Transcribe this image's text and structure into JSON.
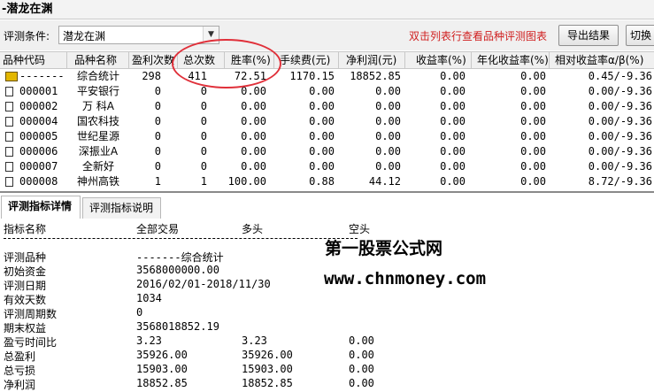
{
  "window": {
    "title": "-潜龙在渊"
  },
  "toolbar": {
    "condition_label": "评测条件:",
    "condition_value": "潜龙在渊",
    "hint": "双击列表行查看品种评测图表",
    "export_label": "导出结果",
    "switch_label": "切换"
  },
  "grid": {
    "headers": [
      "品种代码",
      "品种名称",
      "盈利次数",
      "总次数",
      "胜率(%)",
      "手续费(元)",
      "净利润(元)",
      "收益率(%)",
      "年化收益率(%)",
      "相对收益率α/β(%)"
    ],
    "rows": [
      {
        "code": "-------",
        "name": "综合统计",
        "wins": "298",
        "total": "411",
        "rate": "72.51",
        "fee": "1170.15",
        "profit": "18852.85",
        "ret": "0.00",
        "annual": "0.00",
        "rel": "0.45/-9.36",
        "icon": "summary-icon"
      },
      {
        "code": "000001",
        "name": "平安银行",
        "wins": "0",
        "total": "0",
        "rate": "0.00",
        "fee": "0.00",
        "profit": "0.00",
        "ret": "0.00",
        "annual": "0.00",
        "rel": "0.00/-9.36",
        "icon": "document-icon"
      },
      {
        "code": "000002",
        "name": "万 科A",
        "wins": "0",
        "total": "0",
        "rate": "0.00",
        "fee": "0.00",
        "profit": "0.00",
        "ret": "0.00",
        "annual": "0.00",
        "rel": "0.00/-9.36",
        "icon": "document-icon"
      },
      {
        "code": "000004",
        "name": "国农科技",
        "wins": "0",
        "total": "0",
        "rate": "0.00",
        "fee": "0.00",
        "profit": "0.00",
        "ret": "0.00",
        "annual": "0.00",
        "rel": "0.00/-9.36",
        "icon": "document-icon"
      },
      {
        "code": "000005",
        "name": "世纪星源",
        "wins": "0",
        "total": "0",
        "rate": "0.00",
        "fee": "0.00",
        "profit": "0.00",
        "ret": "0.00",
        "annual": "0.00",
        "rel": "0.00/-9.36",
        "icon": "document-icon"
      },
      {
        "code": "000006",
        "name": "深振业A",
        "wins": "0",
        "total": "0",
        "rate": "0.00",
        "fee": "0.00",
        "profit": "0.00",
        "ret": "0.00",
        "annual": "0.00",
        "rel": "0.00/-9.36",
        "icon": "document-icon"
      },
      {
        "code": "000007",
        "name": "全新好",
        "wins": "0",
        "total": "0",
        "rate": "0.00",
        "fee": "0.00",
        "profit": "0.00",
        "ret": "0.00",
        "annual": "0.00",
        "rel": "0.00/-9.36",
        "icon": "document-icon"
      },
      {
        "code": "000008",
        "name": "神州高铁",
        "wins": "1",
        "total": "1",
        "rate": "100.00",
        "fee": "0.88",
        "profit": "44.12",
        "ret": "0.00",
        "annual": "0.00",
        "rel": "8.72/-9.36",
        "icon": "document-icon"
      }
    ]
  },
  "tabs": [
    "评测指标详情",
    "评测指标说明"
  ],
  "detail": {
    "header": {
      "name": "指标名称",
      "all": "全部交易",
      "long": "多头",
      "short": "空头"
    },
    "rows": [
      {
        "label": "评测品种",
        "all": "-------综合统计",
        "long": "",
        "short": ""
      },
      {
        "label": "初始资金",
        "all": "3568000000.00",
        "long": "",
        "short": ""
      },
      {
        "label": "评测日期",
        "all": "2016/02/01-2018/11/30",
        "long": "",
        "short": ""
      },
      {
        "label": "有效天数",
        "all": "1034",
        "long": "",
        "short": ""
      },
      {
        "label": "评测周期数",
        "all": "0",
        "long": "",
        "short": ""
      },
      {
        "label": "期末权益",
        "all": "3568018852.19",
        "long": "",
        "short": ""
      },
      {
        "label": "盈亏时间比",
        "all": "3.23",
        "long": "3.23",
        "short": "0.00"
      },
      {
        "label": "总盈利",
        "all": "35926.00",
        "long": "35926.00",
        "short": "0.00"
      },
      {
        "label": "总亏损",
        "all": "15903.00",
        "long": "15903.00",
        "short": "0.00"
      },
      {
        "label": "净利润",
        "all": "18852.85",
        "long": "18852.85",
        "short": "0.00"
      }
    ]
  },
  "watermark": {
    "line1": "第一股票公式网",
    "line2": "www.chnmoney.com"
  },
  "colors": {
    "hint": "#d02020",
    "highlight_circle": "#e0303a",
    "summary_icon": "#e3b700"
  }
}
